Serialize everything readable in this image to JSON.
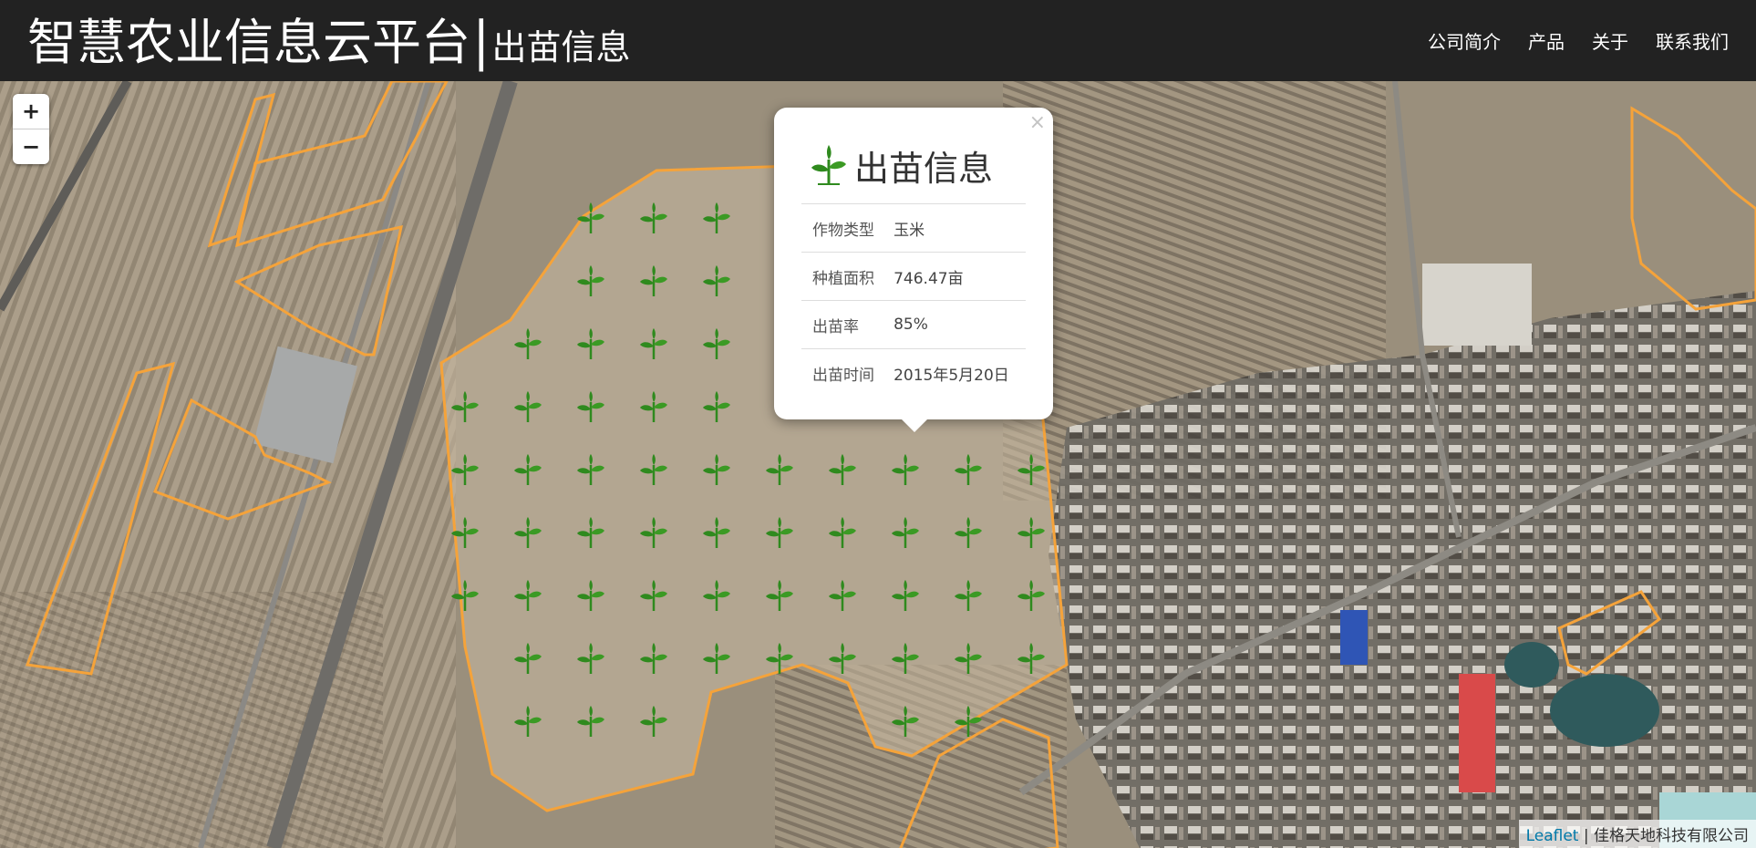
{
  "header": {
    "title": "智慧农业信息云平台",
    "separator": "|",
    "subtitle": "出苗信息",
    "nav": [
      "公司简介",
      "产品",
      "关于",
      "联系我们"
    ]
  },
  "map": {
    "zoom_in": "+",
    "zoom_out": "−",
    "boundary_color": "#f5a33a",
    "sprout_color": "#2f8a1e",
    "attribution": {
      "link": "Leaflet",
      "separator": " | ",
      "text": "佳格天地科技有限公司"
    }
  },
  "popup": {
    "close": "×",
    "title": "出苗信息",
    "icon": "sprout-icon",
    "rows": [
      {
        "label": "作物类型",
        "value": "玉米"
      },
      {
        "label": "种植面积",
        "value": "746.47亩"
      },
      {
        "label": "出苗率",
        "value": "85%"
      },
      {
        "label": "出苗时间",
        "value": "2015年5月20日"
      }
    ]
  }
}
